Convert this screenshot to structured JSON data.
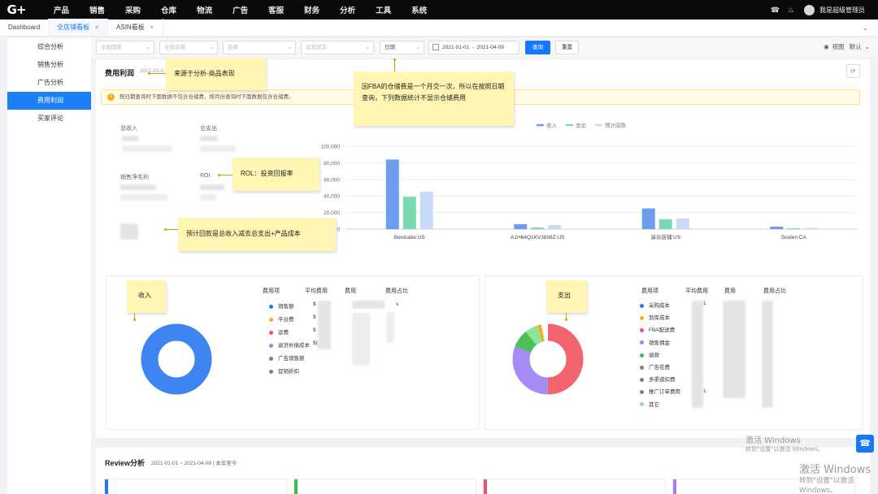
{
  "nav": {
    "logo": "G+",
    "items": [
      "产品",
      "销售",
      "采购",
      "仓库",
      "物流",
      "广告",
      "客服",
      "财务",
      "分析",
      "工具",
      "系统"
    ],
    "user": "我是超级管理员"
  },
  "tabs": [
    {
      "label": "Dashboard"
    },
    {
      "label": "全店铺看板"
    },
    {
      "label": "ASIN看板"
    }
  ],
  "sidebar": {
    "items": [
      "综合分析",
      "销售分析",
      "广告分析",
      "费用利润",
      "买家评论"
    ],
    "active_index": 3
  },
  "filters": {
    "marketplace_placeholder": "全部国家",
    "store_placeholder": "全部店铺",
    "brand_placeholder": "品类",
    "status_placeholder": "运营状态",
    "date_type": "日期",
    "date_start": "2021-01-01",
    "date_sep": "-",
    "date_end": "2021-04-09",
    "query_label": "查询",
    "reset_label": "重置",
    "view_label": "视图",
    "default_label": "默认"
  },
  "section": {
    "title": "费用利润",
    "date": "2021-01-0",
    "notice": "按日期查询时下面数据不包含仓储费，按月份查询时下面数据包含仓储费。"
  },
  "kpis": {
    "total_income": "总收入",
    "total_expense": "总支出",
    "net_profit": "销售净毛利",
    "roi": "ROI"
  },
  "chart_data": {
    "type": "bar",
    "categories": [
      "Benicabe:US",
      "A1H64Q1KV3808Z:US",
      "演示店铺:US",
      "Soulen:CA"
    ],
    "series": [
      {
        "name": "收入",
        "color": "#6e9df0",
        "values": [
          84000,
          6000,
          25000,
          3000
        ]
      },
      {
        "name": "支出",
        "color": "#7ad9b0",
        "values": [
          39000,
          2000,
          12000,
          1000
        ]
      },
      {
        "name": "预计回款",
        "color": "#c8daf7",
        "values": [
          45000,
          5000,
          13000,
          1500
        ]
      }
    ],
    "ylim": [
      0,
      100000
    ],
    "yticks": [
      "0",
      "20,000",
      "40,000",
      "60,000",
      "80,000",
      "100,000"
    ],
    "grid": true,
    "legend_position": "top-center"
  },
  "annotations": {
    "source": "来源于分析-商品表现",
    "fba_note": "因FBA的仓储费是一个月交一次，所以在按照日期查询，下列数据统计不显示仓储费用",
    "roi_note": "ROL：投资回报率",
    "payback_note": "预计回款是总收入减去总支出+产品成本",
    "income_note": "收入",
    "expense_note": "支出"
  },
  "income": {
    "headers": [
      "费用项",
      "平均费用",
      "费用",
      "费用占比"
    ],
    "items": [
      {
        "label": "销售额",
        "color": "#1e7bf0"
      },
      {
        "label": "平台费",
        "color": "#f5b020"
      },
      {
        "label": "运费",
        "color": "#f05070"
      },
      {
        "label": "退货补偿成本",
        "color": "#a47ff0"
      },
      {
        "label": "广告销售额",
        "color": "#7f7f7f"
      },
      {
        "label": "促销折扣",
        "color": "#7f7f7f"
      }
    ],
    "visible_values": [
      "$",
      "$",
      "$",
      "$(",
      "s"
    ]
  },
  "expense": {
    "headers": [
      "费用项",
      "平均费用",
      "费用",
      "费用占比"
    ],
    "items": [
      {
        "label": "采购成本",
        "color": "#1e7bf0"
      },
      {
        "label": "到库成本",
        "color": "#f5b020"
      },
      {
        "label": "FBA配送费",
        "color": "#f05070"
      },
      {
        "label": "销售佣金",
        "color": "#a47ff0"
      },
      {
        "label": "退款",
        "color": "#3cbf4a"
      },
      {
        "label": "广告花费",
        "color": "#7f7f7f"
      },
      {
        "label": "多渠道扣费",
        "color": "#7f7f7f"
      },
      {
        "label": "推广订单费用",
        "color": "#7f7f7f"
      },
      {
        "label": "其它",
        "color": "#90e09a"
      }
    ],
    "visible_values": [
      "1",
      "1"
    ]
  },
  "review": {
    "title": "Review分析",
    "date": "2021-01-01 ~ 2021-04-09 | 本年至今",
    "card_colors": [
      "#1e7bf0",
      "#3cbf4a",
      "#f05070",
      "#a47ff0"
    ]
  },
  "watermark": {
    "line1": "激活 Windows",
    "line2": "转到\"设置\"以激活 Windows。"
  }
}
